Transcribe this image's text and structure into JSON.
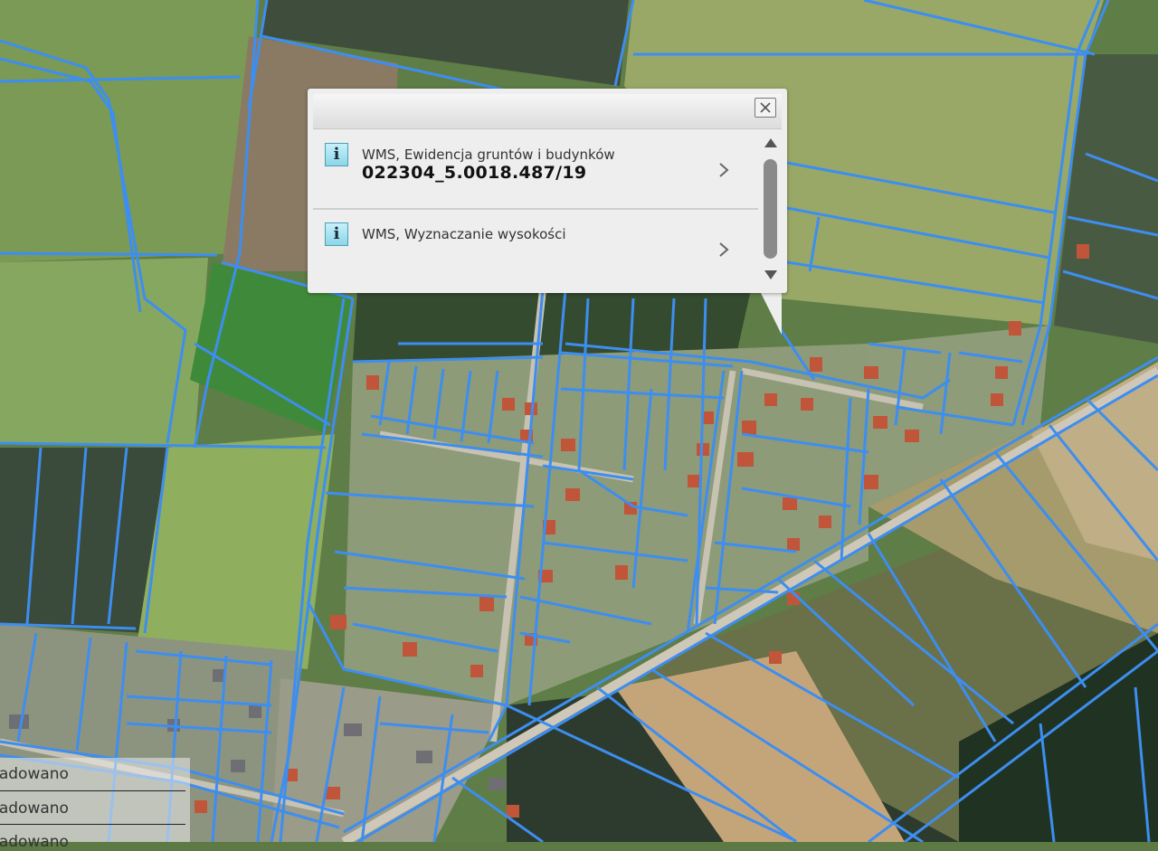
{
  "popup": {
    "results": [
      {
        "layer": "WMS, Ewidencja gruntów i budynków",
        "value": "022304_5.0018.487/19",
        "icon": "info-icon"
      },
      {
        "layer": "WMS, Wyznaczanie wysokości",
        "value": "",
        "icon": "info-icon"
      }
    ]
  },
  "status": {
    "lines": [
      "ładowano",
      "ładowano",
      "ładowano"
    ]
  },
  "colors": {
    "parcel_line": "#3d8ef0",
    "popup_bg": "#eeeeee",
    "info_icon": "#a8e4f2"
  }
}
